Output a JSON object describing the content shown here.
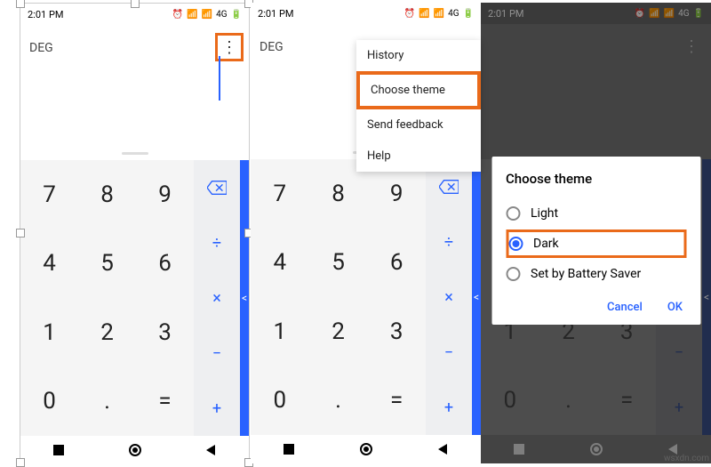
{
  "status": {
    "time": "2:01 PM",
    "net": "4G",
    "battery": "18"
  },
  "calc": {
    "mode": "DEG",
    "keys": [
      "7",
      "8",
      "9",
      "4",
      "5",
      "6",
      "1",
      "2",
      "3",
      "0",
      ".",
      "="
    ],
    "ops": [
      "÷",
      "×",
      "−",
      "+"
    ]
  },
  "menu": {
    "history": "History",
    "choose_theme": "Choose theme",
    "send_feedback": "Send feedback",
    "help": "Help"
  },
  "dialog": {
    "title": "Choose theme",
    "light": "Light",
    "dark": "Dark",
    "battery": "Set by Battery Saver",
    "cancel": "Cancel",
    "ok": "OK"
  },
  "watermark": "wsxdn.com"
}
